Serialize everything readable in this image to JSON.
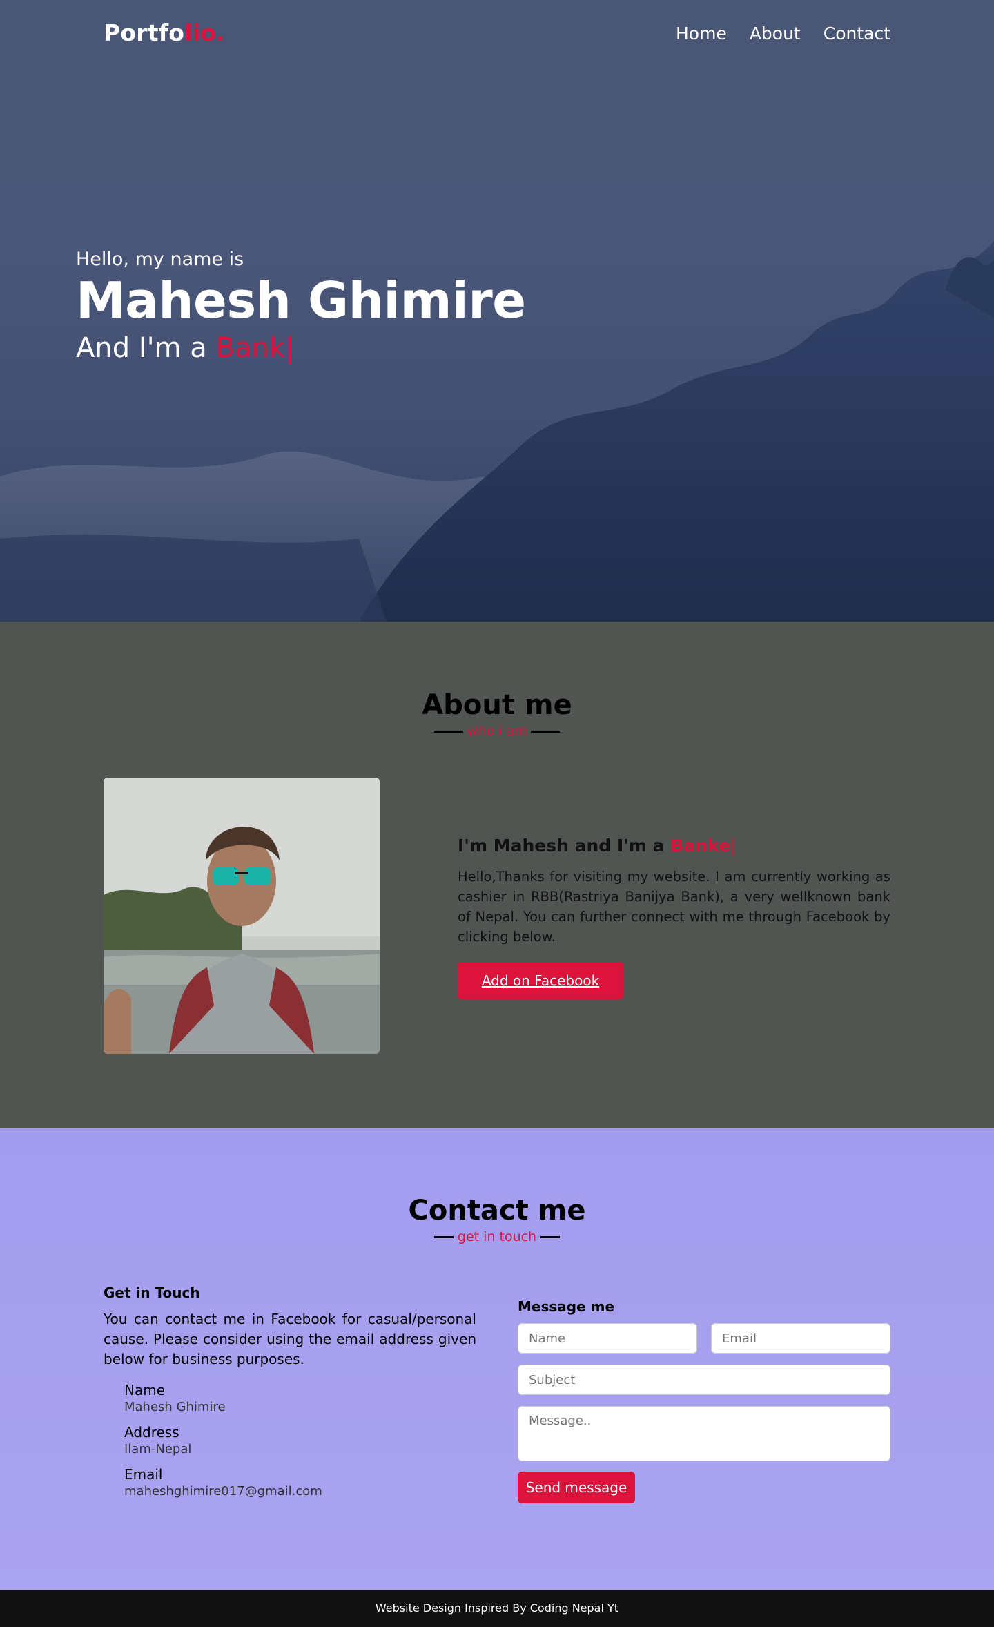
{
  "nav": {
    "logo_main": "Portfo",
    "logo_accent": "lio.",
    "items": [
      {
        "label": "Home"
      },
      {
        "label": "About"
      },
      {
        "label": "Contact"
      }
    ]
  },
  "hero": {
    "greeting": "Hello, my name is",
    "name": "Mahesh Ghimire",
    "role_prefix": "And I'm a ",
    "role_typing": "Bank|"
  },
  "about": {
    "title": "About me",
    "subtitle": "who i am",
    "headline_prefix": "I'm Mahesh and I'm a ",
    "headline_typing": "Banke|",
    "paragraph": "Hello,Thanks for visiting my website. I am currently working as cashier in RBB(Rastriya Banijya Bank), a very wellknown bank of Nepal. You can further connect with me through Facebook by clicking below.",
    "button_label": "Add on Facebook"
  },
  "contact": {
    "title": "Contact me",
    "subtitle": "get in touch",
    "left_heading": "Get in Touch",
    "left_text": "You can contact me in Facebook for casual/personal cause. Please consider using the email address given below for business purposes.",
    "info": [
      {
        "label": "Name",
        "value": "Mahesh Ghimire"
      },
      {
        "label": "Address",
        "value": "Ilam-Nepal"
      },
      {
        "label": "Email",
        "value": "maheshghimire017@gmail.com"
      }
    ],
    "form": {
      "heading": "Message me",
      "name_placeholder": "Name",
      "email_placeholder": "Email",
      "subject_placeholder": "Subject",
      "message_placeholder": "Message..",
      "send_label": "Send message"
    }
  },
  "footer": {
    "text": "Website Design Inspired By Coding Nepal Yt"
  },
  "colors": {
    "accent": "#dc143c",
    "hero_overlay": "#4b5778",
    "about_bg": "#515552",
    "contact_bg": "#a7a0ef",
    "footer_bg": "#111111"
  }
}
